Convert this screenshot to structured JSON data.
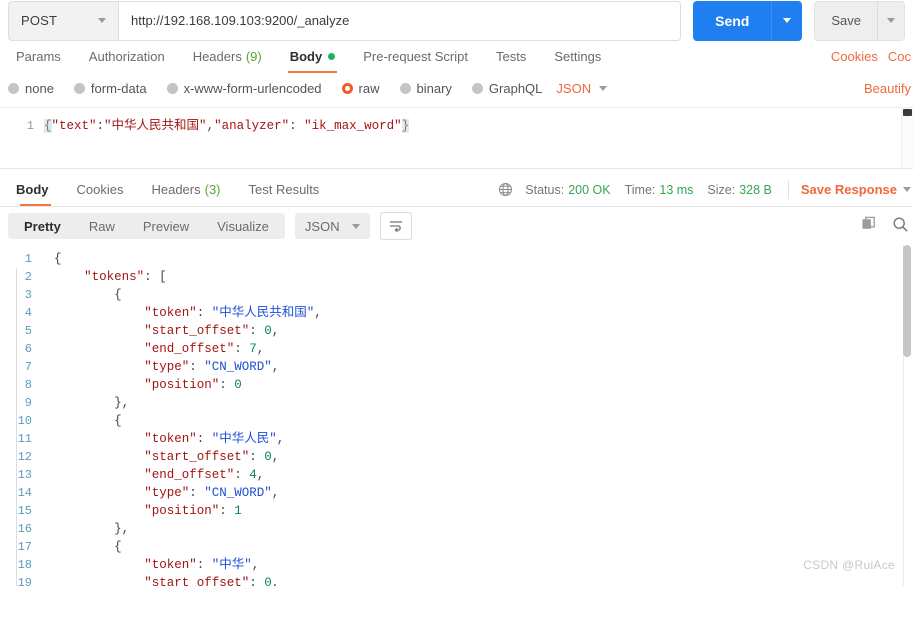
{
  "request": {
    "method": "POST",
    "url": "http://192.168.109.103:9200/_analyze",
    "send_label": "Send",
    "save_label": "Save",
    "tabs": [
      {
        "label": "Params",
        "active": false
      },
      {
        "label": "Authorization",
        "active": false
      },
      {
        "label": "Headers",
        "count": "(9)",
        "active": false
      },
      {
        "label": "Body",
        "active": true,
        "dot": true
      },
      {
        "label": "Pre-request Script",
        "active": false
      },
      {
        "label": "Tests",
        "active": false
      },
      {
        "label": "Settings",
        "active": false
      }
    ],
    "header_links": [
      "Cookies",
      "Coc"
    ],
    "body_types": [
      {
        "label": "none",
        "selected": false
      },
      {
        "label": "form-data",
        "selected": false
      },
      {
        "label": "x-www-form-urlencoded",
        "selected": false
      },
      {
        "label": "raw",
        "selected": true
      },
      {
        "label": "binary",
        "selected": false
      },
      {
        "label": "GraphQL",
        "selected": false
      }
    ],
    "format_selected": "JSON",
    "beautify_label": "Beautify",
    "editor": {
      "line_number": "1",
      "code_open_brace": "{",
      "code_key_text": "\"text\"",
      "code_colon1": ":",
      "code_val_text": "\"中华人民共和国\"",
      "code_comma": ",",
      "code_key_analyzer": "\"analyzer\"",
      "code_colon2": ": ",
      "code_val_analyzer": "\"ik_max_word\"",
      "code_close_brace": "}"
    }
  },
  "response": {
    "tabs": [
      {
        "label": "Body",
        "active": true
      },
      {
        "label": "Cookies",
        "active": false
      },
      {
        "label": "Headers",
        "count": "(3)",
        "active": false
      },
      {
        "label": "Test Results",
        "active": false
      }
    ],
    "status_label": "Status:",
    "status_value": "200 OK",
    "time_label": "Time:",
    "time_value": "13 ms",
    "size_label": "Size:",
    "size_value": "328 B",
    "save_response_label": "Save Response",
    "view_modes": [
      {
        "label": "Pretty",
        "active": true
      },
      {
        "label": "Raw",
        "active": false
      },
      {
        "label": "Preview",
        "active": false
      },
      {
        "label": "Visualize",
        "active": false
      }
    ],
    "format_selected": "JSON",
    "lines": [
      {
        "num": "1",
        "indent": 0,
        "tokens": [
          {
            "t": "br",
            "v": "{"
          }
        ]
      },
      {
        "num": "2",
        "indent": 1,
        "tokens": [
          {
            "t": "k",
            "v": "\"tokens\""
          },
          {
            "t": "p",
            "v": ": "
          },
          {
            "t": "br",
            "v": "["
          }
        ]
      },
      {
        "num": "3",
        "indent": 2,
        "tokens": [
          {
            "t": "br",
            "v": "{"
          }
        ]
      },
      {
        "num": "4",
        "indent": 3,
        "tokens": [
          {
            "t": "k",
            "v": "\"token\""
          },
          {
            "t": "p",
            "v": ": "
          },
          {
            "t": "s",
            "v": "\"中华人民共和国\""
          },
          {
            "t": "p",
            "v": ","
          }
        ]
      },
      {
        "num": "5",
        "indent": 3,
        "tokens": [
          {
            "t": "k",
            "v": "\"start_offset\""
          },
          {
            "t": "p",
            "v": ": "
          },
          {
            "t": "n",
            "v": "0"
          },
          {
            "t": "p",
            "v": ","
          }
        ]
      },
      {
        "num": "6",
        "indent": 3,
        "tokens": [
          {
            "t": "k",
            "v": "\"end_offset\""
          },
          {
            "t": "p",
            "v": ": "
          },
          {
            "t": "n",
            "v": "7"
          },
          {
            "t": "p",
            "v": ","
          }
        ]
      },
      {
        "num": "7",
        "indent": 3,
        "tokens": [
          {
            "t": "k",
            "v": "\"type\""
          },
          {
            "t": "p",
            "v": ": "
          },
          {
            "t": "s",
            "v": "\"CN_WORD\""
          },
          {
            "t": "p",
            "v": ","
          }
        ]
      },
      {
        "num": "8",
        "indent": 3,
        "tokens": [
          {
            "t": "k",
            "v": "\"position\""
          },
          {
            "t": "p",
            "v": ": "
          },
          {
            "t": "n",
            "v": "0"
          }
        ]
      },
      {
        "num": "9",
        "indent": 2,
        "tokens": [
          {
            "t": "br",
            "v": "},"
          }
        ]
      },
      {
        "num": "10",
        "indent": 2,
        "tokens": [
          {
            "t": "br",
            "v": "{"
          }
        ]
      },
      {
        "num": "11",
        "indent": 3,
        "tokens": [
          {
            "t": "k",
            "v": "\"token\""
          },
          {
            "t": "p",
            "v": ": "
          },
          {
            "t": "s",
            "v": "\"中华人民\""
          },
          {
            "t": "p",
            "v": ","
          }
        ]
      },
      {
        "num": "12",
        "indent": 3,
        "tokens": [
          {
            "t": "k",
            "v": "\"start_offset\""
          },
          {
            "t": "p",
            "v": ": "
          },
          {
            "t": "n",
            "v": "0"
          },
          {
            "t": "p",
            "v": ","
          }
        ]
      },
      {
        "num": "13",
        "indent": 3,
        "tokens": [
          {
            "t": "k",
            "v": "\"end_offset\""
          },
          {
            "t": "p",
            "v": ": "
          },
          {
            "t": "n",
            "v": "4"
          },
          {
            "t": "p",
            "v": ","
          }
        ]
      },
      {
        "num": "14",
        "indent": 3,
        "tokens": [
          {
            "t": "k",
            "v": "\"type\""
          },
          {
            "t": "p",
            "v": ": "
          },
          {
            "t": "s",
            "v": "\"CN_WORD\""
          },
          {
            "t": "p",
            "v": ","
          }
        ]
      },
      {
        "num": "15",
        "indent": 3,
        "tokens": [
          {
            "t": "k",
            "v": "\"position\""
          },
          {
            "t": "p",
            "v": ": "
          },
          {
            "t": "n",
            "v": "1"
          }
        ]
      },
      {
        "num": "16",
        "indent": 2,
        "tokens": [
          {
            "t": "br",
            "v": "},"
          }
        ]
      },
      {
        "num": "17",
        "indent": 2,
        "tokens": [
          {
            "t": "br",
            "v": "{"
          }
        ]
      },
      {
        "num": "18",
        "indent": 3,
        "tokens": [
          {
            "t": "k",
            "v": "\"token\""
          },
          {
            "t": "p",
            "v": ": "
          },
          {
            "t": "s",
            "v": "\"中华\""
          },
          {
            "t": "p",
            "v": ","
          }
        ]
      },
      {
        "num": "19",
        "indent": 3,
        "tokens": [
          {
            "t": "k",
            "v": "\"start_offset\""
          },
          {
            "t": "p",
            "v": ": "
          },
          {
            "t": "n",
            "v": "0"
          },
          {
            "t": "p",
            "v": ","
          }
        ]
      }
    ]
  },
  "watermark": "CSDN @RuiAce",
  "colors": {
    "accent_orange": "#f2673c",
    "send_blue": "#1f7ff0",
    "status_green": "#32a852",
    "count_green": "#55a532"
  }
}
